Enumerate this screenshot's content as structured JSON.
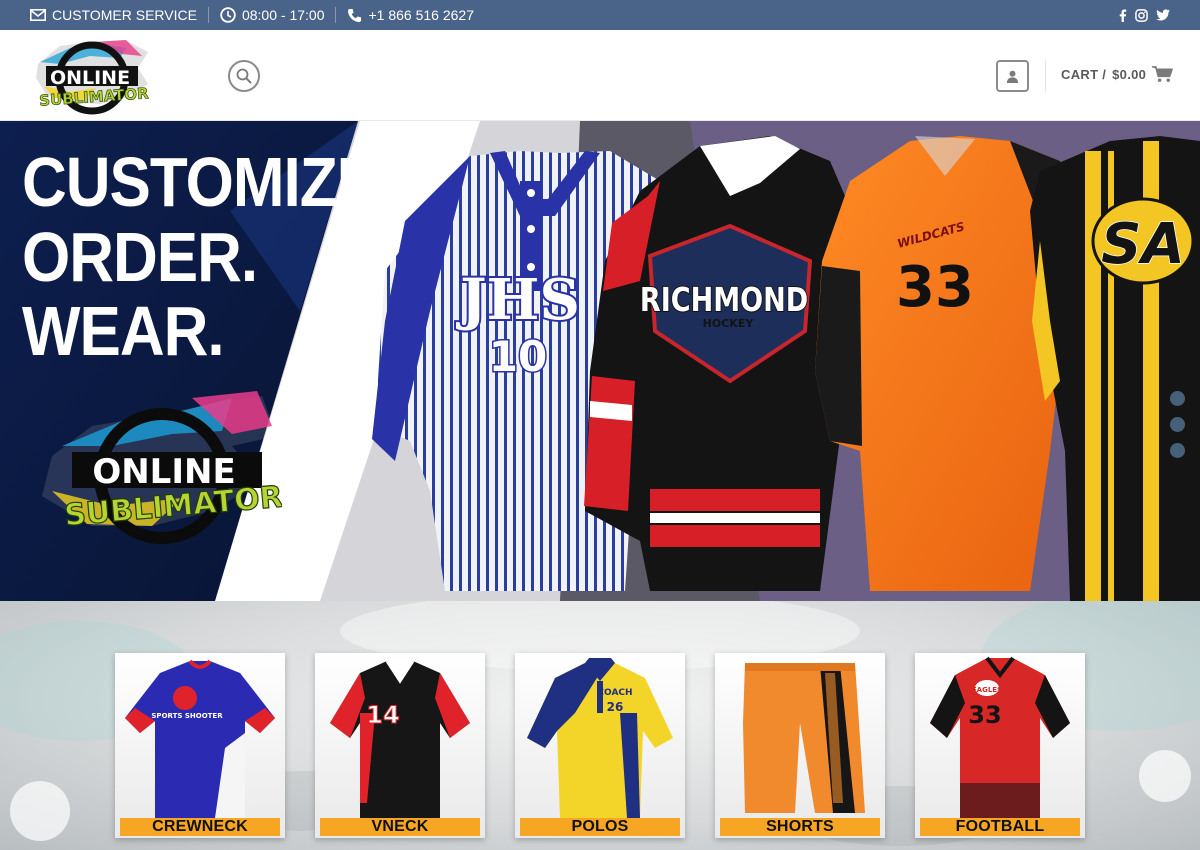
{
  "topbar": {
    "customer_service": "CUSTOMER SERVICE",
    "hours": "08:00 - 17:00",
    "phone": "+1 866 516 2627",
    "social": [
      "facebook-icon",
      "instagram-icon",
      "twitter-icon"
    ],
    "background": "#4a6388"
  },
  "header": {
    "logo_line1": "ONLINE",
    "logo_line2": "SUBLIMATOR",
    "cart_label": "CART /",
    "cart_total": "$0.00"
  },
  "hero": {
    "line1": "CUSTOMIZE.",
    "line2": "ORDER.",
    "line3": "WEAR.",
    "logo_line1": "ONLINE",
    "logo_line2": "SUBLIMATOR",
    "jerseys": {
      "baseball_text": "JHS",
      "baseball_number": "10",
      "hockey_text": "RICHMOND",
      "hockey_sub": "HOCKEY",
      "soccer_text": "WILDCATS",
      "soccer_number": "33",
      "striped_text": "SA"
    },
    "slide_dots": 3
  },
  "categories": [
    {
      "label": "CREWNECK",
      "jersey_text": "SPORTS SHOOTER"
    },
    {
      "label": "VNECK",
      "jersey_number": "14"
    },
    {
      "label": "POLOS",
      "jersey_text": "COACH",
      "jersey_number": "26"
    },
    {
      "label": "SHORTS"
    },
    {
      "label": "FOOTBALL",
      "jersey_text": "EAGLES",
      "jersey_number": "33"
    }
  ],
  "colors": {
    "accent_orange": "#f6a623",
    "hero_navy": "#0d1f4f",
    "icon_gray": "#8a8a8a"
  }
}
